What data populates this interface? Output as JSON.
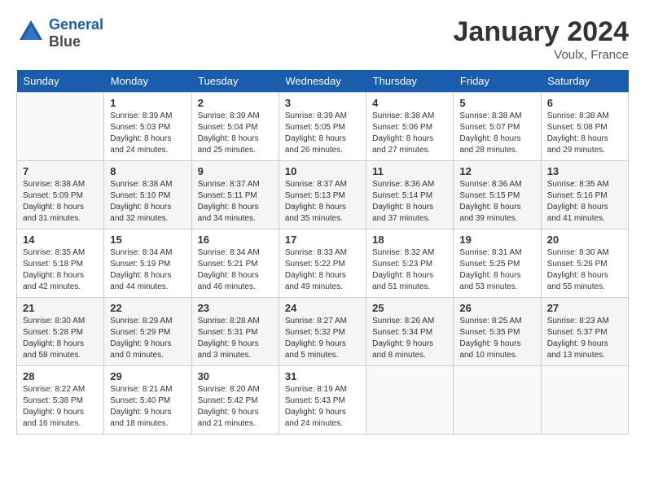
{
  "header": {
    "logo_line1": "General",
    "logo_line2": "Blue",
    "month": "January 2024",
    "location": "Voulx, France"
  },
  "days_of_week": [
    "Sunday",
    "Monday",
    "Tuesday",
    "Wednesday",
    "Thursday",
    "Friday",
    "Saturday"
  ],
  "weeks": [
    [
      {
        "num": "",
        "sunrise": "",
        "sunset": "",
        "daylight": "",
        "empty": true
      },
      {
        "num": "1",
        "sunrise": "Sunrise: 8:39 AM",
        "sunset": "Sunset: 5:03 PM",
        "daylight": "Daylight: 8 hours and 24 minutes."
      },
      {
        "num": "2",
        "sunrise": "Sunrise: 8:39 AM",
        "sunset": "Sunset: 5:04 PM",
        "daylight": "Daylight: 8 hours and 25 minutes."
      },
      {
        "num": "3",
        "sunrise": "Sunrise: 8:39 AM",
        "sunset": "Sunset: 5:05 PM",
        "daylight": "Daylight: 8 hours and 26 minutes."
      },
      {
        "num": "4",
        "sunrise": "Sunrise: 8:38 AM",
        "sunset": "Sunset: 5:06 PM",
        "daylight": "Daylight: 8 hours and 27 minutes."
      },
      {
        "num": "5",
        "sunrise": "Sunrise: 8:38 AM",
        "sunset": "Sunset: 5:07 PM",
        "daylight": "Daylight: 8 hours and 28 minutes."
      },
      {
        "num": "6",
        "sunrise": "Sunrise: 8:38 AM",
        "sunset": "Sunset: 5:08 PM",
        "daylight": "Daylight: 8 hours and 29 minutes."
      }
    ],
    [
      {
        "num": "7",
        "sunrise": "Sunrise: 8:38 AM",
        "sunset": "Sunset: 5:09 PM",
        "daylight": "Daylight: 8 hours and 31 minutes."
      },
      {
        "num": "8",
        "sunrise": "Sunrise: 8:38 AM",
        "sunset": "Sunset: 5:10 PM",
        "daylight": "Daylight: 8 hours and 32 minutes."
      },
      {
        "num": "9",
        "sunrise": "Sunrise: 8:37 AM",
        "sunset": "Sunset: 5:11 PM",
        "daylight": "Daylight: 8 hours and 34 minutes."
      },
      {
        "num": "10",
        "sunrise": "Sunrise: 8:37 AM",
        "sunset": "Sunset: 5:13 PM",
        "daylight": "Daylight: 8 hours and 35 minutes."
      },
      {
        "num": "11",
        "sunrise": "Sunrise: 8:36 AM",
        "sunset": "Sunset: 5:14 PM",
        "daylight": "Daylight: 8 hours and 37 minutes."
      },
      {
        "num": "12",
        "sunrise": "Sunrise: 8:36 AM",
        "sunset": "Sunset: 5:15 PM",
        "daylight": "Daylight: 8 hours and 39 minutes."
      },
      {
        "num": "13",
        "sunrise": "Sunrise: 8:35 AM",
        "sunset": "Sunset: 5:16 PM",
        "daylight": "Daylight: 8 hours and 41 minutes."
      }
    ],
    [
      {
        "num": "14",
        "sunrise": "Sunrise: 8:35 AM",
        "sunset": "Sunset: 5:18 PM",
        "daylight": "Daylight: 8 hours and 42 minutes."
      },
      {
        "num": "15",
        "sunrise": "Sunrise: 8:34 AM",
        "sunset": "Sunset: 5:19 PM",
        "daylight": "Daylight: 8 hours and 44 minutes."
      },
      {
        "num": "16",
        "sunrise": "Sunrise: 8:34 AM",
        "sunset": "Sunset: 5:21 PM",
        "daylight": "Daylight: 8 hours and 46 minutes."
      },
      {
        "num": "17",
        "sunrise": "Sunrise: 8:33 AM",
        "sunset": "Sunset: 5:22 PM",
        "daylight": "Daylight: 8 hours and 49 minutes."
      },
      {
        "num": "18",
        "sunrise": "Sunrise: 8:32 AM",
        "sunset": "Sunset: 5:23 PM",
        "daylight": "Daylight: 8 hours and 51 minutes."
      },
      {
        "num": "19",
        "sunrise": "Sunrise: 8:31 AM",
        "sunset": "Sunset: 5:25 PM",
        "daylight": "Daylight: 8 hours and 53 minutes."
      },
      {
        "num": "20",
        "sunrise": "Sunrise: 8:30 AM",
        "sunset": "Sunset: 5:26 PM",
        "daylight": "Daylight: 8 hours and 55 minutes."
      }
    ],
    [
      {
        "num": "21",
        "sunrise": "Sunrise: 8:30 AM",
        "sunset": "Sunset: 5:28 PM",
        "daylight": "Daylight: 8 hours and 58 minutes."
      },
      {
        "num": "22",
        "sunrise": "Sunrise: 8:29 AM",
        "sunset": "Sunset: 5:29 PM",
        "daylight": "Daylight: 9 hours and 0 minutes."
      },
      {
        "num": "23",
        "sunrise": "Sunrise: 8:28 AM",
        "sunset": "Sunset: 5:31 PM",
        "daylight": "Daylight: 9 hours and 3 minutes."
      },
      {
        "num": "24",
        "sunrise": "Sunrise: 8:27 AM",
        "sunset": "Sunset: 5:32 PM",
        "daylight": "Daylight: 9 hours and 5 minutes."
      },
      {
        "num": "25",
        "sunrise": "Sunrise: 8:26 AM",
        "sunset": "Sunset: 5:34 PM",
        "daylight": "Daylight: 9 hours and 8 minutes."
      },
      {
        "num": "26",
        "sunrise": "Sunrise: 8:25 AM",
        "sunset": "Sunset: 5:35 PM",
        "daylight": "Daylight: 9 hours and 10 minutes."
      },
      {
        "num": "27",
        "sunrise": "Sunrise: 8:23 AM",
        "sunset": "Sunset: 5:37 PM",
        "daylight": "Daylight: 9 hours and 13 minutes."
      }
    ],
    [
      {
        "num": "28",
        "sunrise": "Sunrise: 8:22 AM",
        "sunset": "Sunset: 5:38 PM",
        "daylight": "Daylight: 9 hours and 16 minutes."
      },
      {
        "num": "29",
        "sunrise": "Sunrise: 8:21 AM",
        "sunset": "Sunset: 5:40 PM",
        "daylight": "Daylight: 9 hours and 18 minutes."
      },
      {
        "num": "30",
        "sunrise": "Sunrise: 8:20 AM",
        "sunset": "Sunset: 5:42 PM",
        "daylight": "Daylight: 9 hours and 21 minutes."
      },
      {
        "num": "31",
        "sunrise": "Sunrise: 8:19 AM",
        "sunset": "Sunset: 5:43 PM",
        "daylight": "Daylight: 9 hours and 24 minutes."
      },
      {
        "num": "",
        "sunrise": "",
        "sunset": "",
        "daylight": "",
        "empty": true
      },
      {
        "num": "",
        "sunrise": "",
        "sunset": "",
        "daylight": "",
        "empty": true
      },
      {
        "num": "",
        "sunrise": "",
        "sunset": "",
        "daylight": "",
        "empty": true
      }
    ]
  ]
}
